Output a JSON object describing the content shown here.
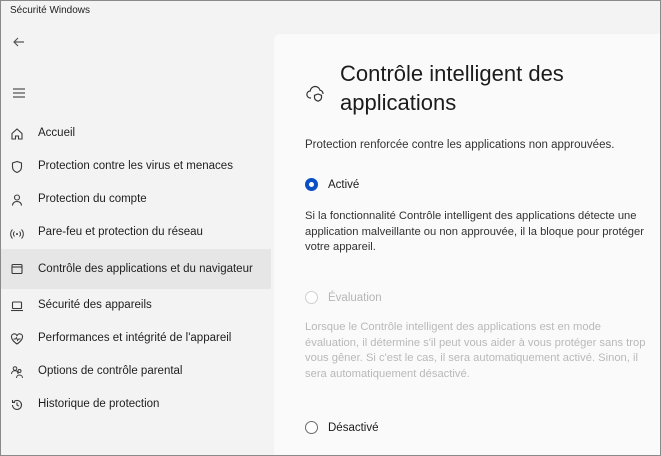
{
  "app": {
    "title": "Sécurité Windows"
  },
  "nav": {
    "items": [
      {
        "label": "Accueil",
        "icon": "home-icon"
      },
      {
        "label": "Protection contre les virus et menaces",
        "icon": "shield-icon"
      },
      {
        "label": "Protection du compte",
        "icon": "person-icon"
      },
      {
        "label": "Pare-feu et protection du réseau",
        "icon": "wifi-icon"
      },
      {
        "label": "Contrôle des applications et du navigateur",
        "icon": "browser-icon",
        "selected": true
      },
      {
        "label": "Sécurité des appareils",
        "icon": "laptop-icon"
      },
      {
        "label": "Performances et intégrité de l'appareil",
        "icon": "heart-icon"
      },
      {
        "label": "Options de contrôle parental",
        "icon": "family-icon"
      },
      {
        "label": "Historique de protection",
        "icon": "history-icon"
      }
    ]
  },
  "main": {
    "title": "Contrôle intelligent des applications",
    "description": "Protection renforcée contre les applications non approuvées.",
    "options": [
      {
        "label": "Activé",
        "state": "selected",
        "text": "Si la fonctionnalité Contrôle intelligent des applications détecte une application malveillante ou non approuvée, il la bloque pour protéger votre appareil."
      },
      {
        "label": "Évaluation",
        "state": "disabled",
        "text": "Lorsque le Contrôle intelligent des applications est en mode évaluation, il détermine s'il peut vous aider à vous protéger sans trop vous gêner. Si c'est le cas, il sera automatiquement activé. Sinon, il sera automatiquement désactivé."
      },
      {
        "label": "Désactivé",
        "state": "unselected"
      }
    ]
  },
  "colors": {
    "accent": "#0a4fc4",
    "sidebar_bg": "#f3f3f3",
    "content_bg": "#fafafa",
    "selected_bg": "#e6e6e6"
  }
}
